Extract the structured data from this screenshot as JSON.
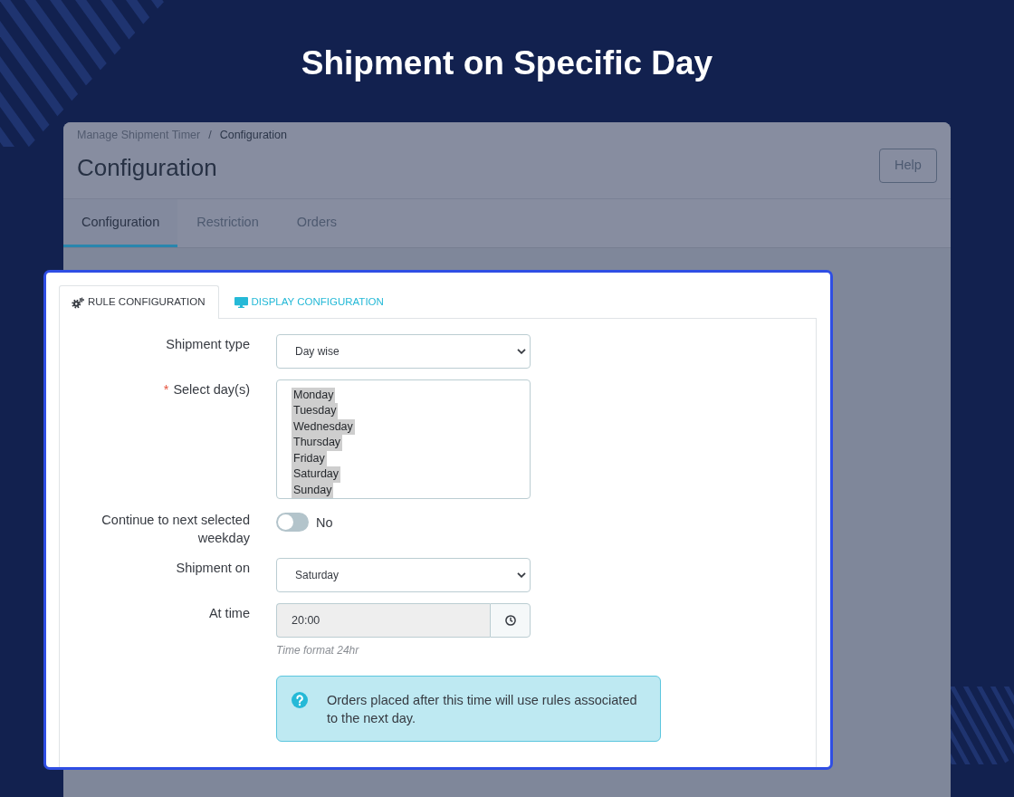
{
  "title": "Shipment on Specific Day",
  "admin_page": {
    "breadcrumb": {
      "items": [
        "Manage Shipment Timer",
        "Configuration"
      ],
      "separator": "/"
    },
    "page_title": "Configuration",
    "help_button": "Help",
    "tabs": [
      {
        "label": "Configuration",
        "selected": true
      },
      {
        "label": "Restriction",
        "selected": false
      },
      {
        "label": "Orders",
        "selected": false
      }
    ]
  },
  "config_panel": {
    "tabs": [
      {
        "label": "RULE CONFIGURATION",
        "selected": true
      },
      {
        "label": "DISPLAY CONFIGURATION",
        "selected": false
      }
    ],
    "fields": [
      {
        "kind": "select",
        "label": "Shipment type",
        "value": "Day wise"
      },
      {
        "kind": "multiselect",
        "label": "Select day(s)",
        "required_mark": "*",
        "options": [
          {
            "label": "Monday",
            "selected": true
          },
          {
            "label": "Tuesday",
            "selected": true
          },
          {
            "label": "Wednesday",
            "selected": true
          },
          {
            "label": "Thursday",
            "selected": true
          },
          {
            "label": "Friday",
            "selected": true
          },
          {
            "label": "Saturday",
            "selected": true
          },
          {
            "label": "Sunday",
            "selected": true
          }
        ]
      },
      {
        "kind": "toggle",
        "label": "Continue to next selected weekday",
        "on": false,
        "state_label": "No"
      },
      {
        "kind": "select",
        "label": "Shipment on",
        "value": "Saturday"
      },
      {
        "kind": "time",
        "label": "At time",
        "value": "20:00",
        "help": "Time format 24hr"
      }
    ],
    "info_alert": {
      "text": "Orders placed after this time will use rules associated to the next day."
    }
  }
}
